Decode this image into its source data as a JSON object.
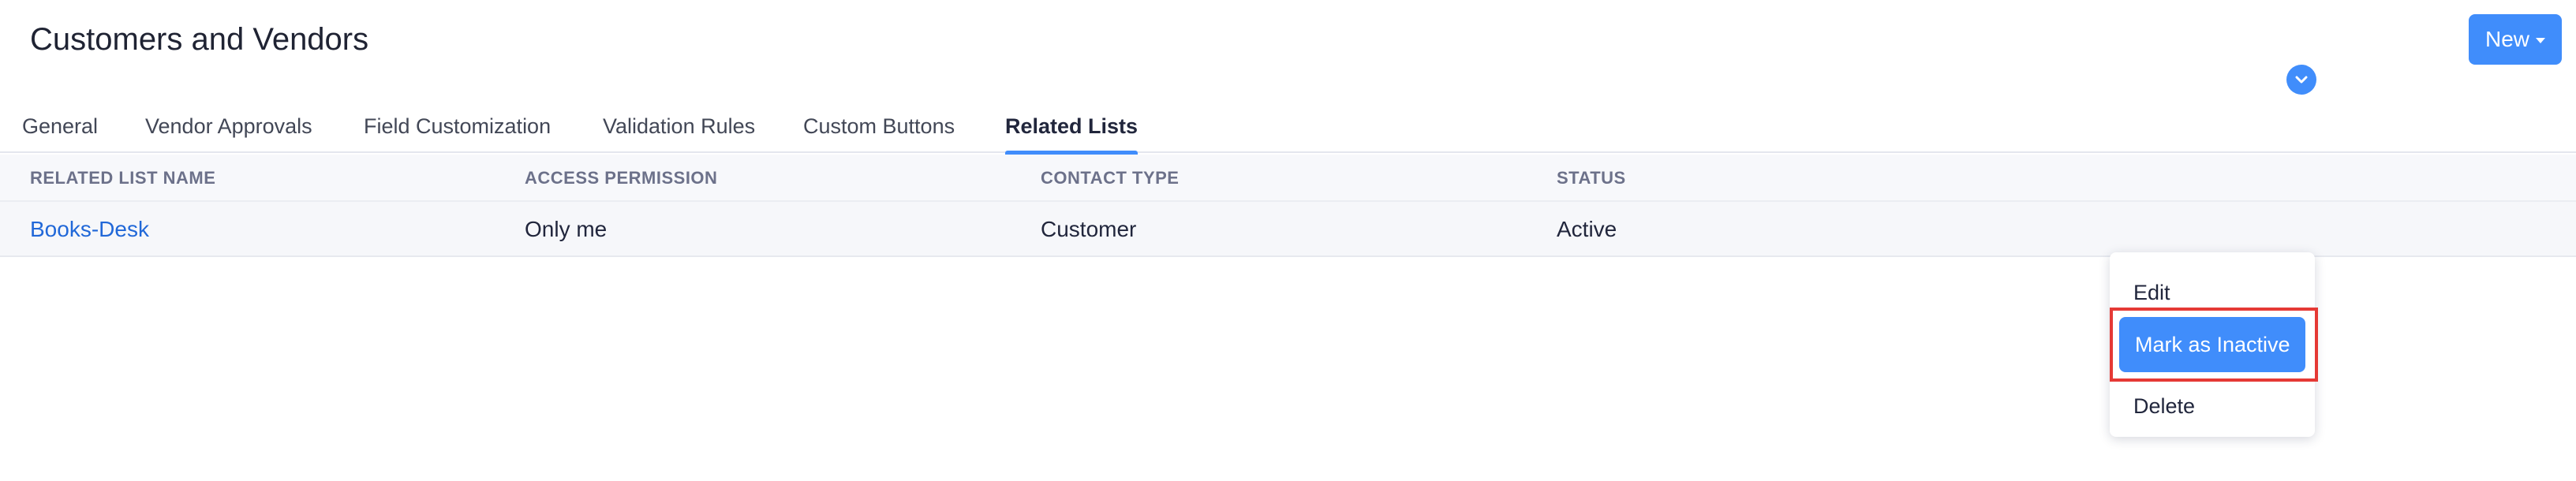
{
  "header": {
    "title": "Customers and Vendors",
    "new_button": "New"
  },
  "tabs": [
    {
      "label": "General"
    },
    {
      "label": "Vendor Approvals"
    },
    {
      "label": "Field Customization"
    },
    {
      "label": "Validation Rules"
    },
    {
      "label": "Custom Buttons"
    },
    {
      "label": "Related Lists",
      "active": true
    }
  ],
  "table": {
    "columns": [
      "RELATED LIST NAME",
      "ACCESS PERMISSION",
      "CONTACT TYPE",
      "STATUS"
    ],
    "rows": [
      {
        "name": "Books-Desk",
        "access": "Only me",
        "contact_type": "Customer",
        "status": "Active"
      }
    ]
  },
  "row_menu": {
    "items": [
      {
        "label": "Edit"
      },
      {
        "label": "Mark as Inactive",
        "highlighted": true
      },
      {
        "label": "Delete"
      }
    ]
  },
  "colors": {
    "accent": "#408dfb",
    "link": "#2168d8",
    "highlight_border": "#e53935"
  }
}
